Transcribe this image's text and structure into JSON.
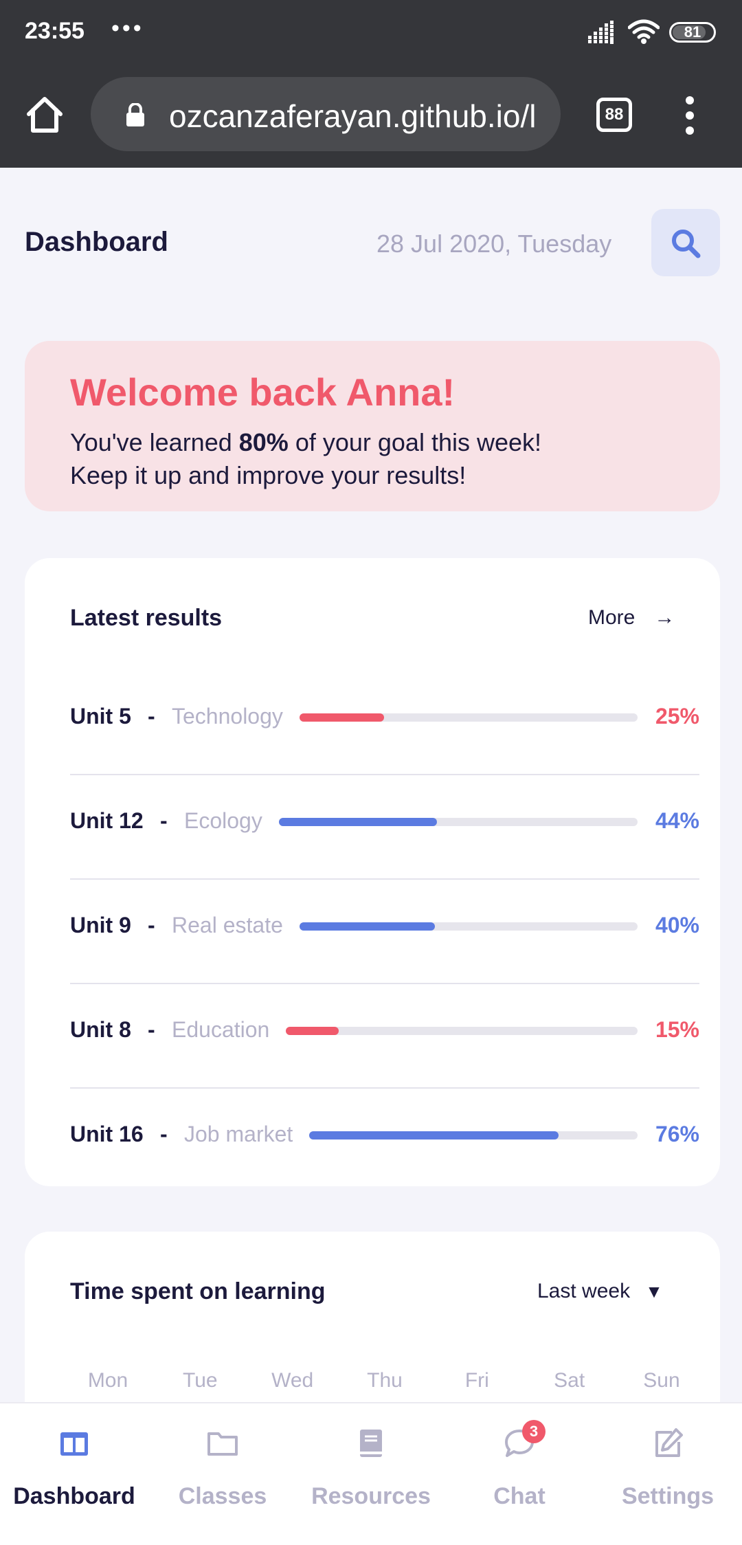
{
  "status_bar": {
    "time": "23:55",
    "more_dots": "•••",
    "battery": "81"
  },
  "browser": {
    "url": "ozcanzaferayan.github.io/l",
    "tab_count": "88"
  },
  "header": {
    "title": "Dashboard",
    "date": "28 Jul 2020, Tuesday"
  },
  "welcome": {
    "title": "Welcome back Anna!",
    "line1_prefix": "You've learned ",
    "line1_bold": "80%",
    "line1_suffix": " of your goal this week!",
    "line2": "Keep it up and improve your results!"
  },
  "latest_results": {
    "title": "Latest results",
    "more_label": "More",
    "more_arrow": "→",
    "rows": [
      {
        "unit": "Unit 5",
        "dash": "-",
        "subject": "Technology",
        "percent_label": "25%",
        "progress": 0.25,
        "color": "#f0596b"
      },
      {
        "unit": "Unit 12",
        "dash": "-",
        "subject": "Ecology",
        "percent_label": "44%",
        "progress": 0.44,
        "color": "#5b7be1"
      },
      {
        "unit": "Unit 9",
        "dash": "-",
        "subject": "Real estate",
        "percent_label": "40%",
        "progress": 0.4,
        "color": "#5b7be1"
      },
      {
        "unit": "Unit 8",
        "dash": "-",
        "subject": "Education",
        "percent_label": "15%",
        "progress": 0.15,
        "color": "#f0596b"
      },
      {
        "unit": "Unit 16",
        "dash": "-",
        "subject": "Job market",
        "percent_label": "76%",
        "progress": 0.76,
        "color": "#5b7be1"
      }
    ]
  },
  "time_spent": {
    "title": "Time spent on learning",
    "period": "Last week",
    "caret": "▼",
    "days": [
      "Mon",
      "Tue",
      "Wed",
      "Thu",
      "Fri",
      "Sat",
      "Sun"
    ]
  },
  "bottom_nav": {
    "items": [
      {
        "label": "Dashboard",
        "icon": "dashboard-icon",
        "active": true
      },
      {
        "label": "Classes",
        "icon": "folder-icon",
        "active": false
      },
      {
        "label": "Resources",
        "icon": "book-icon",
        "active": false
      },
      {
        "label": "Chat",
        "icon": "chat-icon",
        "active": false,
        "badge": "3"
      },
      {
        "label": "Settings",
        "icon": "edit-icon",
        "active": false
      }
    ]
  },
  "colors": {
    "accent_red": "#f0596b",
    "accent_blue": "#5b7be1",
    "text_dark": "#1c1a3c",
    "text_muted": "#b4b2c8"
  }
}
